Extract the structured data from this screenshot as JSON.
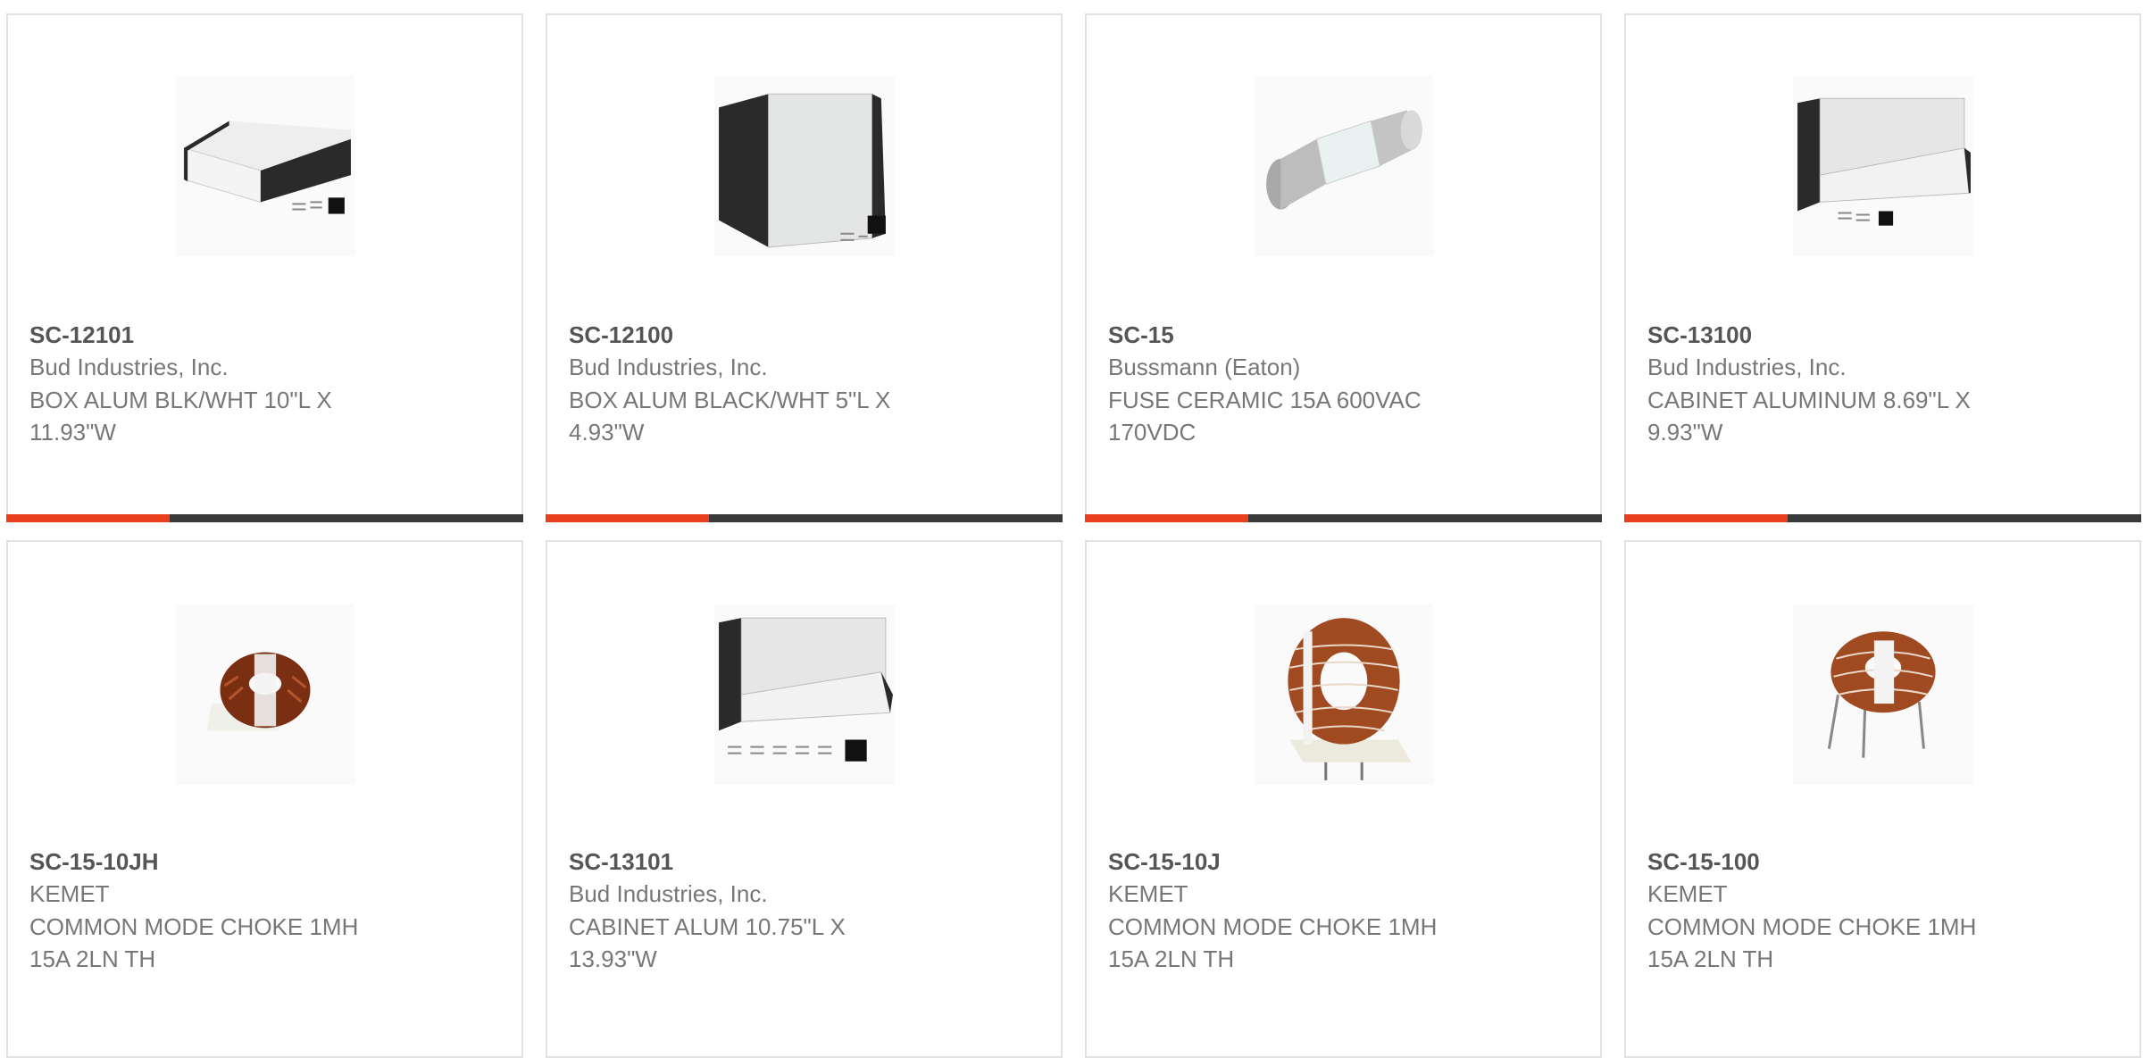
{
  "accent_color": "#e8401c",
  "track_color": "#3a3a3a",
  "products": [
    {
      "part_number": "SC-12101",
      "manufacturer": "Bud Industries, Inc.",
      "desc1": "BOX ALUM BLK/WHT 10\"L X",
      "desc2": "11.93\"W",
      "image": "box-enclosure-slope"
    },
    {
      "part_number": "SC-12100",
      "manufacturer": "Bud Industries, Inc.",
      "desc1": "BOX ALUM BLACK/WHT 5\"L X",
      "desc2": "4.93\"W",
      "image": "box-enclosure-tall"
    },
    {
      "part_number": "SC-15",
      "manufacturer": "Bussmann (Eaton)",
      "desc1": "FUSE CERAMIC 15A 600VAC",
      "desc2": "170VDC",
      "image": "fuse"
    },
    {
      "part_number": "SC-13100",
      "manufacturer": "Bud Industries, Inc.",
      "desc1": "CABINET ALUMINUM 8.69\"L X",
      "desc2": "9.93\"W",
      "image": "cabinet-console"
    },
    {
      "part_number": "SC-15-10JH",
      "manufacturer": "KEMET",
      "desc1": "COMMON MODE CHOKE 1MH",
      "desc2": "15A 2LN TH",
      "image": "toroid-choke-small"
    },
    {
      "part_number": "SC-13101",
      "manufacturer": "Bud Industries, Inc.",
      "desc1": "CABINET ALUM 10.75\"L X",
      "desc2": "13.93\"W",
      "image": "cabinet-console-large"
    },
    {
      "part_number": "SC-15-10J",
      "manufacturer": "KEMET",
      "desc1": "COMMON MODE CHOKE 1MH",
      "desc2": "15A 2LN TH",
      "image": "toroid-choke-vertical"
    },
    {
      "part_number": "SC-15-100",
      "manufacturer": "KEMET",
      "desc1": "COMMON MODE CHOKE 1MH",
      "desc2": "15A 2LN TH",
      "image": "toroid-choke-pins"
    }
  ]
}
